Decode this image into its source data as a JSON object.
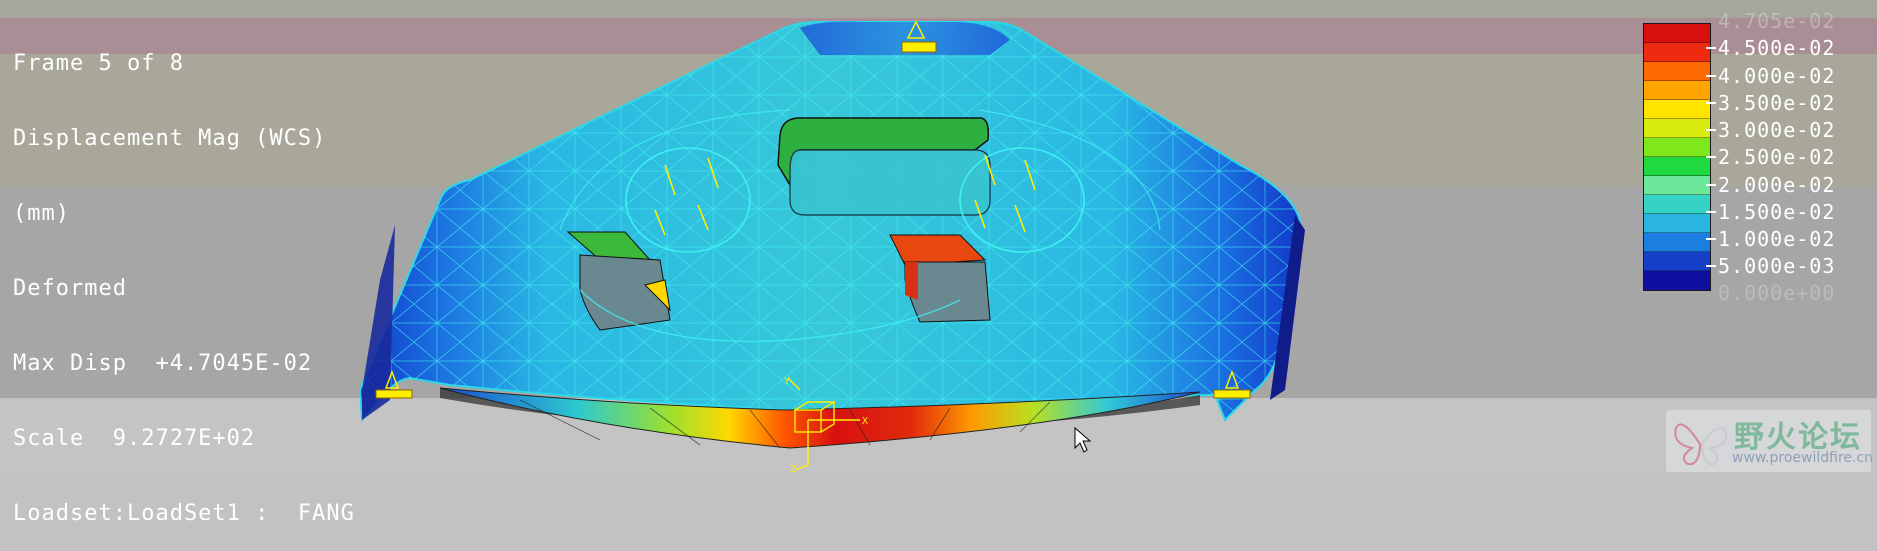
{
  "info": {
    "frame": "Frame 5 of 8",
    "quantity": "Displacement Mag (WCS)",
    "units": "(mm)",
    "mode": "Deformed",
    "max_disp": "Max Disp  +4.7045E-02",
    "scale": "Scale  9.2727E+02",
    "loadset": "Loadset:LoadSet1 :  FANG"
  },
  "legend": {
    "labels": [
      "4.705e-02",
      "4.500e-02",
      "4.000e-02",
      "3.500e-02",
      "3.000e-02",
      "2.500e-02",
      "2.000e-02",
      "1.500e-02",
      "1.000e-02",
      "5.000e-03",
      "0.000e+00"
    ],
    "colors": [
      "#d81010",
      "#ee2a10",
      "#ff6a00",
      "#ffa400",
      "#ffe400",
      "#d8ec10",
      "#7ee81c",
      "#20d840",
      "#6ce89a",
      "#36d2c6",
      "#2ab4e0",
      "#1c7ee0",
      "#1640c8",
      "#1010a0"
    ]
  },
  "watermark": {
    "brand": "野火论坛",
    "url": "www.proewildfire.cn"
  },
  "colors": {
    "mesh_line": "#3ff0f0",
    "constraint": "#ffee00"
  }
}
